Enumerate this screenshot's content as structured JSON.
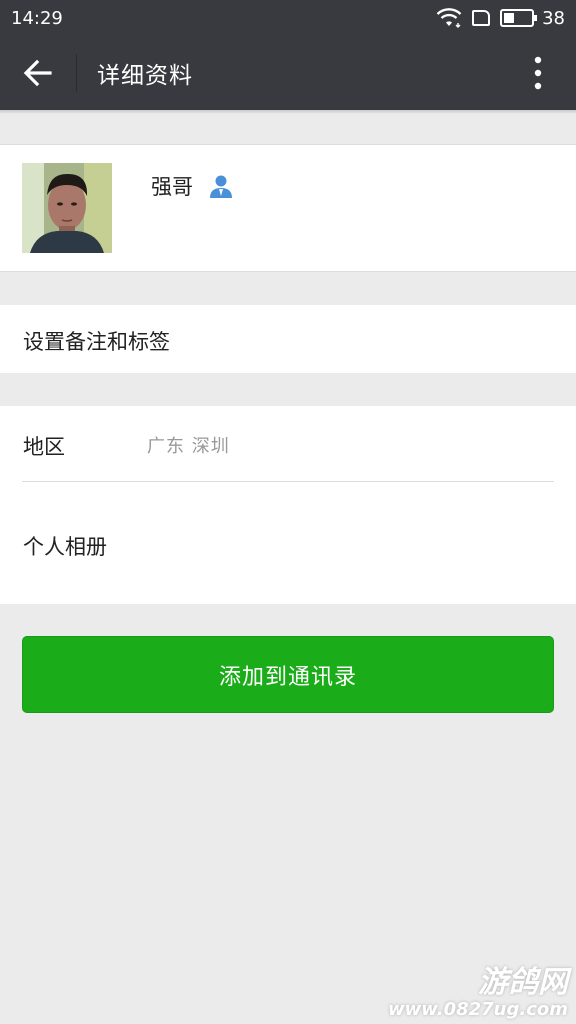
{
  "status_bar": {
    "time": "14:29",
    "battery_level": "38",
    "battery_fraction": 0.38,
    "icons": [
      "wifi-icon",
      "sim-icon",
      "battery-icon"
    ]
  },
  "app_bar": {
    "title": "详细资料",
    "back_icon": "arrow-left-icon",
    "more_icon": "more-vertical-icon"
  },
  "profile": {
    "name": "强哥",
    "avatar_icon": "avatar-photo",
    "contact_badge_icon": "person-icon",
    "contact_badge_color": "#4a90d9"
  },
  "remark": {
    "label": "设置备注和标签"
  },
  "info": {
    "region_label": "地区",
    "region_value": "广东  深圳",
    "album_label": "个人相册"
  },
  "actions": {
    "add_contact_label": "添加到通讯录",
    "accent_color": "#1aad19"
  },
  "watermark": {
    "title": "游鸽网",
    "url": "www.0827ug.com"
  }
}
